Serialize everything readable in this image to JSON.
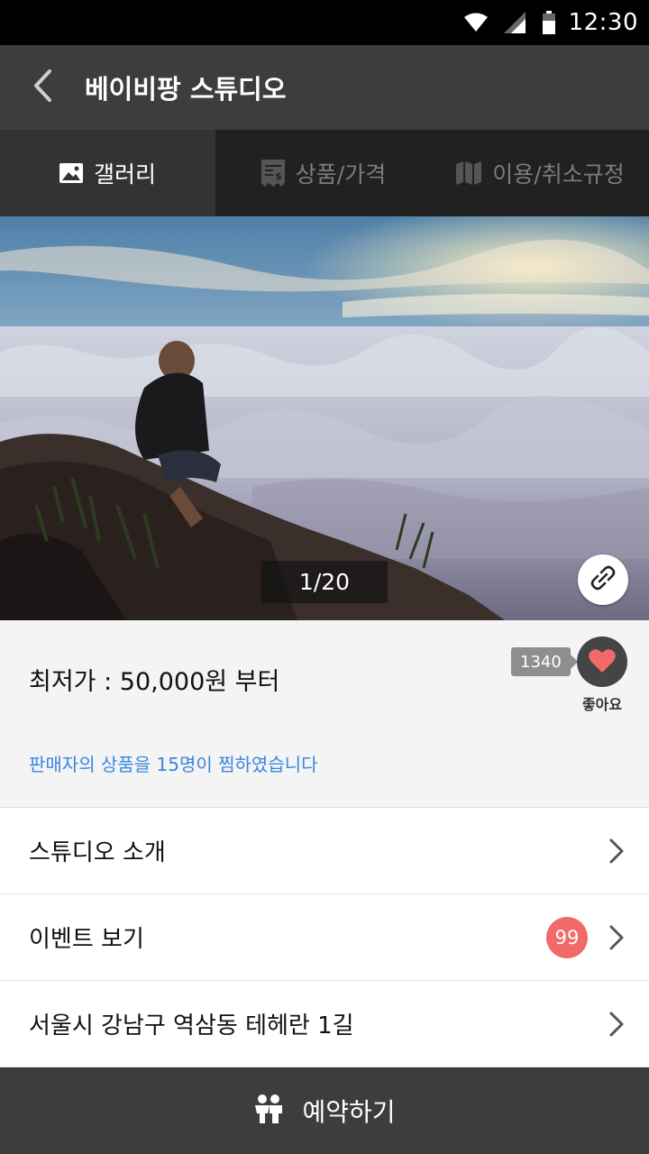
{
  "status_bar": {
    "time": "12:30",
    "icons": [
      "wifi-icon",
      "signal-icon",
      "battery-icon"
    ]
  },
  "app_bar": {
    "title": "베이비팡 스튜디오",
    "back_icon": "chevron-left-icon"
  },
  "tabs": [
    {
      "label": "갤러리",
      "icon": "image-icon",
      "active": true
    },
    {
      "label": "상품/가격",
      "icon": "receipt-icon",
      "active": false
    },
    {
      "label": "이용/취소규정",
      "icon": "map-icon",
      "active": false
    }
  ],
  "gallery": {
    "counter": "1/20",
    "link_icon": "link-icon"
  },
  "price": {
    "text": "최저가 : 50,000원 부터",
    "wish_text": "판매자의 상품을 15명이 찜하였습니다",
    "like_count": "1340",
    "like_label": "좋아요"
  },
  "menu": [
    {
      "label": "스튜디오 소개",
      "badge": ""
    },
    {
      "label": "이벤트 보기",
      "badge": "99"
    },
    {
      "label": "서울시 강남구 역삼동 테헤란 1길",
      "badge": ""
    }
  ],
  "reserve": {
    "label": "예약하기",
    "icon": "people-icon"
  },
  "colors": {
    "app_bar": "#3d3d3d",
    "tab_bar": "#212121",
    "link_blue": "#3b86e0",
    "badge_red": "#f06a6a",
    "heart": "#f06a6a"
  }
}
